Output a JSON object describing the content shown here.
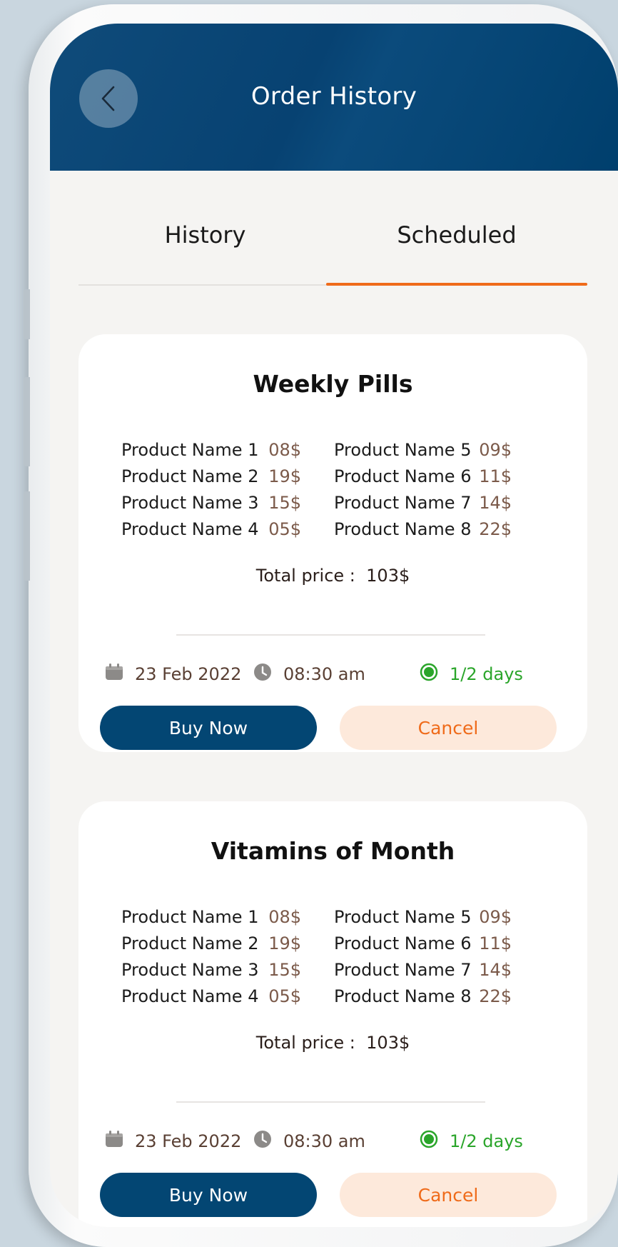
{
  "header": {
    "title": "Order History",
    "back_icon": "chevron-left-icon"
  },
  "tabs": [
    {
      "label": "History",
      "active": false
    },
    {
      "label": "Scheduled",
      "active": true
    }
  ],
  "accent_color": "#ef6b1a",
  "brand_color": "#034673",
  "cards": [
    {
      "title": "Weekly Pills",
      "products_left": [
        {
          "name": "Product Name 1",
          "price": "08$"
        },
        {
          "name": "Product Name 2",
          "price": "19$"
        },
        {
          "name": "Product Name 3",
          "price": "15$"
        },
        {
          "name": "Product Name 4",
          "price": "05$"
        }
      ],
      "products_right": [
        {
          "name": "Product Name 5",
          "price": "09$"
        },
        {
          "name": "Product Name 6",
          "price": "11$"
        },
        {
          "name": "Product Name 7",
          "price": "14$"
        },
        {
          "name": "Product Name 8",
          "price": "22$"
        }
      ],
      "total_label": "Total price :",
      "total_value": "103$",
      "date": "23 Feb 2022",
      "time": "08:30 am",
      "frequency": "1/2 days",
      "buy_label": "Buy Now",
      "cancel_label": "Cancel"
    },
    {
      "title": "Vitamins of Month",
      "products_left": [
        {
          "name": "Product Name 1",
          "price": "08$"
        },
        {
          "name": "Product Name 2",
          "price": "19$"
        },
        {
          "name": "Product Name 3",
          "price": "15$"
        },
        {
          "name": "Product Name 4",
          "price": "05$"
        }
      ],
      "products_right": [
        {
          "name": "Product Name 5",
          "price": "09$"
        },
        {
          "name": "Product Name 6",
          "price": "11$"
        },
        {
          "name": "Product Name 7",
          "price": "14$"
        },
        {
          "name": "Product Name 8",
          "price": "22$"
        }
      ],
      "total_label": "Total price :",
      "total_value": "103$",
      "date": "23 Feb 2022",
      "time": "08:30 am",
      "frequency": "1/2 days",
      "buy_label": "Buy Now",
      "cancel_label": "Cancel"
    }
  ]
}
